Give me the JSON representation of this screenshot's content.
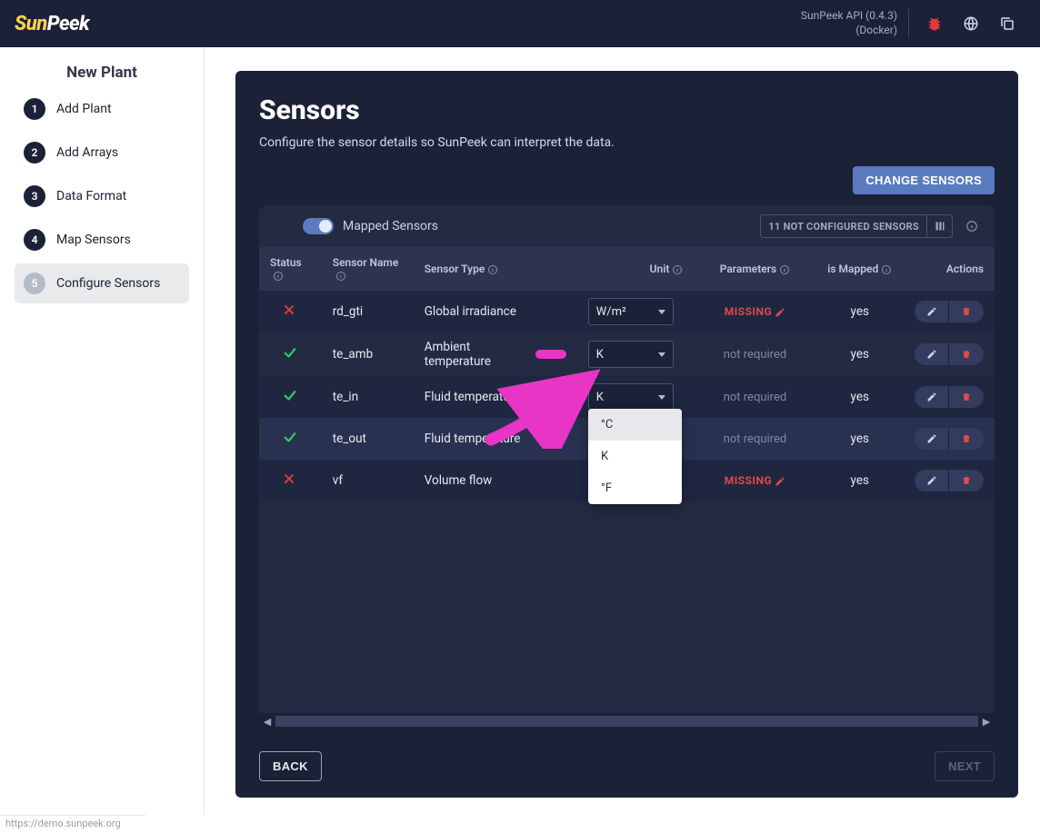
{
  "header": {
    "logo_a": "Sun",
    "logo_b": "Peek",
    "api_line1": "SunPeek API (0.4.3)",
    "api_line2": "(Docker)"
  },
  "sidebar": {
    "heading": "New Plant",
    "steps": [
      {
        "num": "1",
        "label": "Add Plant",
        "active": false
      },
      {
        "num": "2",
        "label": "Add Arrays",
        "active": false
      },
      {
        "num": "3",
        "label": "Data Format",
        "active": false
      },
      {
        "num": "4",
        "label": "Map Sensors",
        "active": false
      },
      {
        "num": "5",
        "label": "Configure Sensors",
        "active": true
      }
    ]
  },
  "page": {
    "title": "Sensors",
    "subtitle": "Configure the sensor details so SunPeek can interpret the data.",
    "change_sensors_btn": "CHANGE SENSORS",
    "back_btn": "BACK",
    "next_btn": "NEXT"
  },
  "toolbar": {
    "mapped_label": "Mapped Sensors",
    "not_configured": "11 NOT CONFIGURED SENSORS"
  },
  "columns": {
    "status": "Status",
    "name": "Sensor Name",
    "type": "Sensor Type",
    "unit": "Unit",
    "params": "Parameters",
    "mapped": "is Mapped",
    "actions": "Actions"
  },
  "rows": [
    {
      "status": "bad",
      "name": "rd_gti",
      "type": "Global irradiance",
      "marker": false,
      "unit": "W/m²",
      "unit_open": false,
      "params": "MISSING",
      "params_kind": "missing",
      "mapped": "yes"
    },
    {
      "status": "ok",
      "name": "te_amb",
      "type": "Ambient temperature",
      "marker": true,
      "unit": "K",
      "unit_open": false,
      "params": "not required",
      "params_kind": "na",
      "mapped": "yes"
    },
    {
      "status": "ok",
      "name": "te_in",
      "type": "Fluid temperature",
      "marker": true,
      "unit": "K",
      "unit_open": false,
      "params": "not required",
      "params_kind": "na",
      "mapped": "yes"
    },
    {
      "status": "ok",
      "name": "te_out",
      "type": "Fluid temperature",
      "marker": false,
      "unit": "°C",
      "unit_open": true,
      "params": "not required",
      "params_kind": "na",
      "mapped": "yes"
    },
    {
      "status": "bad",
      "name": "vf",
      "type": "Volume flow",
      "marker": false,
      "unit": "",
      "unit_open": false,
      "params": "MISSING",
      "params_kind": "missing",
      "mapped": "yes"
    }
  ],
  "dropdown": {
    "options": [
      "°C",
      "K",
      "°F"
    ],
    "selected_index": 0
  },
  "status_url": "https://demo.sunpeek.org"
}
